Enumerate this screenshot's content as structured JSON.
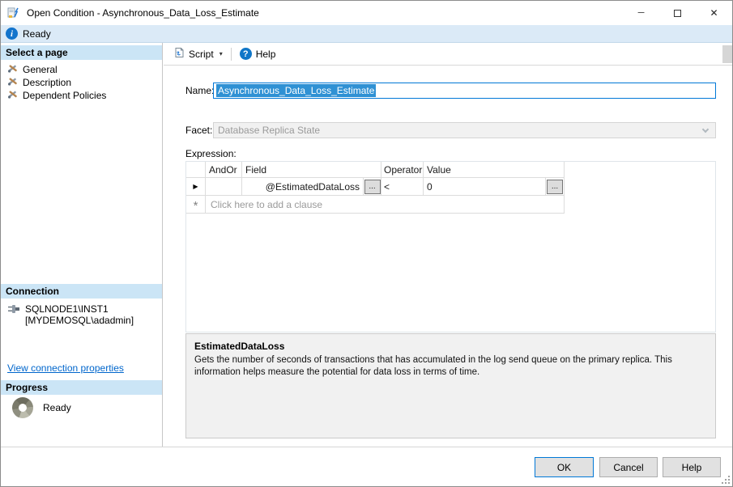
{
  "colors": {
    "accent_blue": "#0078d7",
    "selection_blue": "#2f91d4",
    "panel_header_blue": "#cbe5f6",
    "statusbar_blue": "#dbeaf7",
    "link_blue": "#0066cc"
  },
  "window": {
    "title": "Open Condition - Asynchronous_Data_Loss_Estimate"
  },
  "icons": {
    "minimize": "─",
    "close": "✕",
    "info": "i",
    "help": "?",
    "dropdown": "▾",
    "row_current": "▶",
    "row_new": "*",
    "ellipsis": "..."
  },
  "statusbar": {
    "text": "Ready"
  },
  "sidebar": {
    "select_page_header": "Select a page",
    "pages": [
      {
        "label": "General"
      },
      {
        "label": "Description"
      },
      {
        "label": "Dependent Policies"
      }
    ],
    "connection_header": "Connection",
    "connection": {
      "server": "SQLNODE1\\INST1",
      "account": "[MYDEMOSQL\\adadmin]"
    },
    "connection_link": "View connection properties",
    "progress_header": "Progress",
    "progress_status": "Ready"
  },
  "toolbar": {
    "script_label": "Script",
    "help_label": "Help"
  },
  "form": {
    "name_label": "Name:",
    "name_value": "Asynchronous_Data_Loss_Estimate",
    "facet_label": "Facet:",
    "facet_value": "Database Replica State",
    "expression_label": "Expression:"
  },
  "grid": {
    "headers": {
      "andor": "AndOr",
      "field": "Field",
      "operator": "Operator",
      "value": "Value"
    },
    "row": {
      "field": "@EstimatedDataLoss",
      "operator": "<",
      "value": "0"
    },
    "add_clause": "Click here to add a clause"
  },
  "description": {
    "title": "EstimatedDataLoss",
    "text": "Gets the number of seconds of transactions that has accumulated in the log send queue on the primary replica. This information helps measure the potential for data loss in terms of time."
  },
  "footer": {
    "ok": "OK",
    "cancel": "Cancel",
    "help": "Help"
  }
}
